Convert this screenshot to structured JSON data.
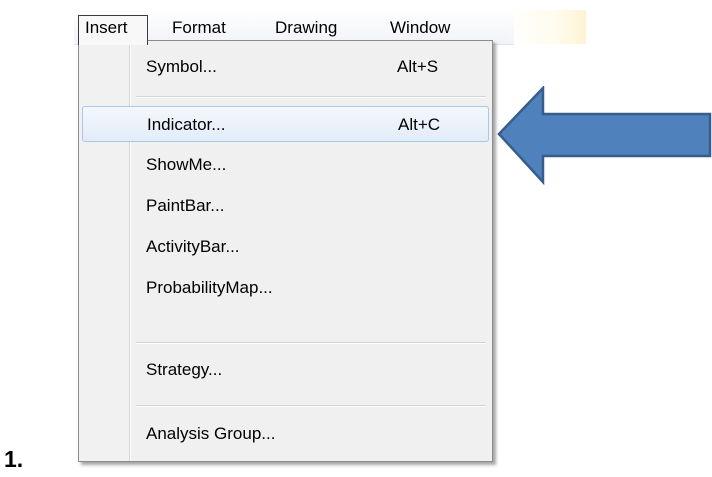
{
  "step_label": "1.",
  "menubar": {
    "items": [
      {
        "label": "Insert",
        "active": true
      },
      {
        "label": "Format"
      },
      {
        "label": "Drawing"
      },
      {
        "label": "Window"
      }
    ]
  },
  "dropdown": {
    "items": [
      {
        "label": "Symbol...",
        "shortcut": "Alt+S"
      },
      {
        "label": "Indicator...",
        "shortcut": "Alt+C",
        "highlighted": true
      },
      {
        "label": "ShowMe..."
      },
      {
        "label": "PaintBar..."
      },
      {
        "label": "ActivityBar..."
      },
      {
        "label": "ProbabilityMap..."
      },
      {
        "label": "Strategy..."
      },
      {
        "label": "Analysis Group..."
      }
    ]
  },
  "colors": {
    "arrow_fill": "#4f81bd",
    "arrow_stroke": "#385d8a",
    "highlight_border": "#a9c7e8",
    "menu_background": "#f0f0f0"
  },
  "annotation": {
    "icon": "arrow-left-icon"
  }
}
